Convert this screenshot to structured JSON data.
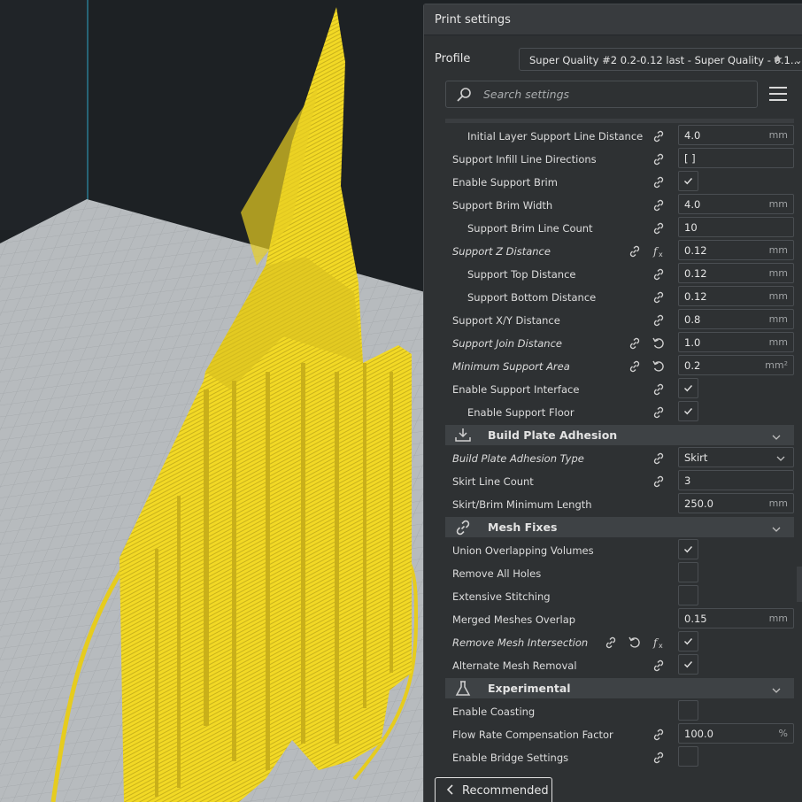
{
  "panel": {
    "title": "Print settings",
    "profile_label": "Profile",
    "profile_value": "Super Quality #2 0.2-0.12 last - Super Quality - 0.1…",
    "search_placeholder": "Search settings"
  },
  "rows": [
    {
      "label": "Initial Layer Support Line Distance",
      "indent": true,
      "italic": false,
      "icons": [
        "link"
      ],
      "type": "field",
      "value": "4.0",
      "unit": "mm"
    },
    {
      "label": "Support Infill Line Directions",
      "indent": false,
      "italic": false,
      "icons": [
        "link"
      ],
      "type": "field",
      "value": "[ ]",
      "unit": ""
    },
    {
      "label": "Enable Support Brim",
      "indent": false,
      "italic": false,
      "icons": [
        "link"
      ],
      "type": "check",
      "checked": true
    },
    {
      "label": "Support Brim Width",
      "indent": false,
      "italic": false,
      "icons": [
        "link"
      ],
      "type": "field",
      "value": "4.0",
      "unit": "mm"
    },
    {
      "label": "Support Brim Line Count",
      "indent": true,
      "italic": false,
      "icons": [
        "link"
      ],
      "type": "field",
      "value": "10",
      "unit": ""
    },
    {
      "label": "Support Z Distance",
      "indent": false,
      "italic": true,
      "icons": [
        "link",
        "fx"
      ],
      "type": "field",
      "value": "0.12",
      "unit": "mm"
    },
    {
      "label": "Support Top Distance",
      "indent": true,
      "italic": false,
      "icons": [
        "link"
      ],
      "type": "field",
      "value": "0.12",
      "unit": "mm"
    },
    {
      "label": "Support Bottom Distance",
      "indent": true,
      "italic": false,
      "icons": [
        "link"
      ],
      "type": "field",
      "value": "0.12",
      "unit": "mm"
    },
    {
      "label": "Support X/Y Distance",
      "indent": false,
      "italic": false,
      "icons": [
        "link"
      ],
      "type": "field",
      "value": "0.8",
      "unit": "mm"
    },
    {
      "label": "Support Join Distance",
      "indent": false,
      "italic": true,
      "icons": [
        "link",
        "reset"
      ],
      "type": "field",
      "value": "1.0",
      "unit": "mm"
    },
    {
      "label": "Minimum Support Area",
      "indent": false,
      "italic": true,
      "icons": [
        "link",
        "reset"
      ],
      "type": "field",
      "value": "0.2",
      "unit": "mm²"
    },
    {
      "label": "Enable Support Interface",
      "indent": false,
      "italic": false,
      "icons": [
        "link"
      ],
      "type": "check",
      "checked": true
    },
    {
      "label": "Enable Support Floor",
      "indent": true,
      "italic": false,
      "icons": [
        "link"
      ],
      "type": "check",
      "checked": true
    },
    {
      "type": "category",
      "label": "Build Plate Adhesion",
      "icon": "adhesion"
    },
    {
      "label": "Build Plate Adhesion Type",
      "indent": false,
      "italic": true,
      "icons": [
        "link"
      ],
      "type": "select",
      "value": "Skirt"
    },
    {
      "label": "Skirt Line Count",
      "indent": false,
      "italic": false,
      "icons": [
        "link"
      ],
      "type": "field",
      "value": "3",
      "unit": ""
    },
    {
      "label": "Skirt/Brim Minimum Length",
      "indent": false,
      "italic": false,
      "icons": [],
      "type": "field",
      "value": "250.0",
      "unit": "mm"
    },
    {
      "type": "category",
      "label": "Mesh Fixes",
      "icon": "mesh"
    },
    {
      "label": "Union Overlapping Volumes",
      "indent": false,
      "italic": false,
      "icons": [],
      "type": "check",
      "checked": true
    },
    {
      "label": "Remove All Holes",
      "indent": false,
      "italic": false,
      "icons": [],
      "type": "check",
      "checked": false
    },
    {
      "label": "Extensive Stitching",
      "indent": false,
      "italic": false,
      "icons": [],
      "type": "check",
      "checked": false
    },
    {
      "label": "Merged Meshes Overlap",
      "indent": false,
      "italic": false,
      "icons": [],
      "type": "field",
      "value": "0.15",
      "unit": "mm"
    },
    {
      "label": "Remove Mesh Intersection",
      "indent": false,
      "italic": true,
      "icons": [
        "link",
        "reset",
        "fx"
      ],
      "type": "check",
      "checked": true
    },
    {
      "label": "Alternate Mesh Removal",
      "indent": false,
      "italic": false,
      "icons": [
        "link"
      ],
      "type": "check",
      "checked": true
    },
    {
      "type": "category",
      "label": "Experimental",
      "icon": "flask"
    },
    {
      "label": "Enable Coasting",
      "indent": false,
      "italic": false,
      "icons": [],
      "type": "check",
      "checked": false
    },
    {
      "label": "Flow Rate Compensation Factor",
      "indent": false,
      "italic": false,
      "icons": [
        "link"
      ],
      "type": "field",
      "value": "100.0",
      "unit": "%"
    },
    {
      "label": "Enable Bridge Settings",
      "indent": false,
      "italic": false,
      "icons": [
        "link"
      ],
      "type": "check",
      "checked": false
    }
  ],
  "footer": {
    "recommended_label": "Recommended"
  },
  "colors": {
    "model_yellow": "#f5dd2a",
    "panel_bg": "#2e3133",
    "buildplate": "#b5b9bc"
  }
}
